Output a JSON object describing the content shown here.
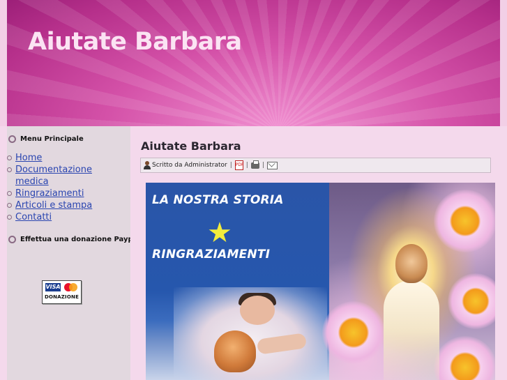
{
  "header": {
    "title": "Aiutate Barbara"
  },
  "sidebar": {
    "menu_title": "Menu Principale",
    "items": [
      {
        "label": "Home"
      },
      {
        "label": "Documentazione medica"
      },
      {
        "label": "Ringraziamenti"
      },
      {
        "label": "Articoli e stampa"
      },
      {
        "label": "Contatti"
      }
    ],
    "donation_title": "Effettua una donazione Paypal",
    "donation_button": {
      "visa": "VISA",
      "label": "DONAZIONE"
    }
  },
  "article": {
    "title": "Aiutate Barbara",
    "author_text": "Scritto da Administrator",
    "separator": "|",
    "pdf_label": "PDF",
    "banner": {
      "line1": "LA NOSTRA STORIA",
      "star": "★",
      "line2": "RINGRAZIAMENTI"
    }
  },
  "colors": {
    "header": "#c43a99",
    "sidebar": "#e2d8df",
    "content": "#f4d9ec",
    "link": "#2a45b0",
    "banner_blue": "#2657ad",
    "star": "#f3ec3c"
  }
}
